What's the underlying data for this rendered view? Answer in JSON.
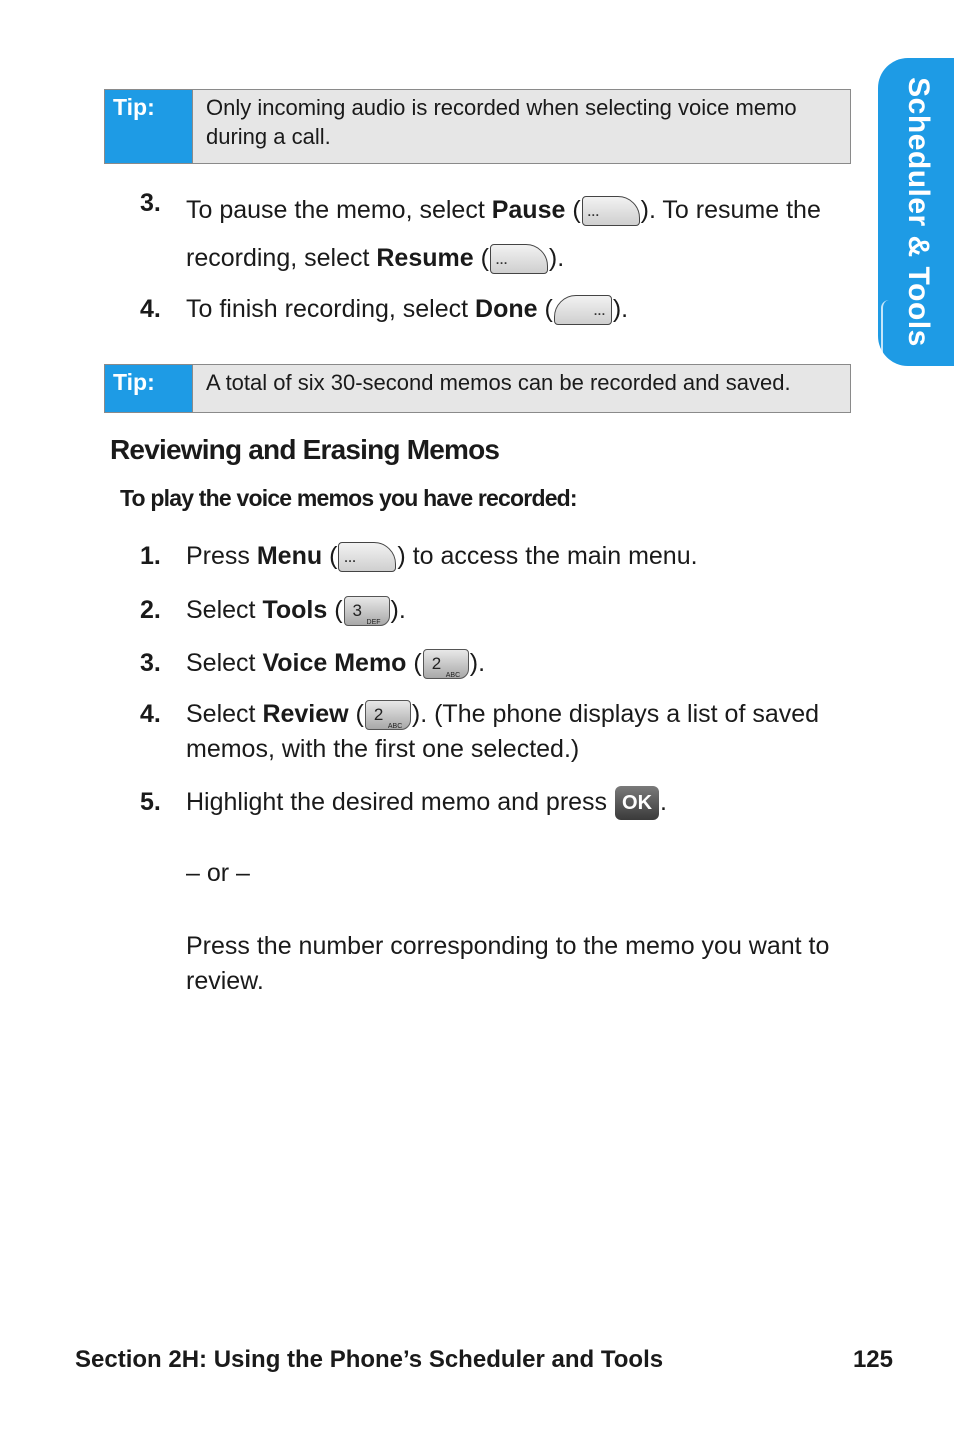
{
  "side_tab": {
    "label": "Scheduler & Tools"
  },
  "tips": [
    {
      "label": "Tip:",
      "text": "Only incoming audio is recorded when selecting voice memo during a call."
    },
    {
      "label": "Tip:",
      "text": "A total of six 30-second memos can be recorded and saved."
    }
  ],
  "steps_top": [
    {
      "num": "3.",
      "t1": "To pause the memo, select ",
      "b1": "Pause",
      "t2": " (",
      "t3": "). To resume the recording, select ",
      "b2": "Resume",
      "t4": " (",
      "t5": ")."
    },
    {
      "num": "4.",
      "t1": "To finish recording, select ",
      "b1": "Done",
      "t2": " (",
      "t3": ")."
    }
  ],
  "section": {
    "heading": "Reviewing and Erasing Memos",
    "subheading": "To play the voice memos you have recorded:",
    "steps": [
      {
        "num": "1.",
        "t1": "Press ",
        "b1": "Menu",
        "t2": " (",
        "t3": ") to access the main menu."
      },
      {
        "num": "2.",
        "t1": "Select ",
        "b1": "Tools",
        "t2": " (",
        "t3": ")."
      },
      {
        "num": "3.",
        "t1": "Select ",
        "b1": "Voice Memo",
        "t2": " (",
        "t3": ")."
      },
      {
        "num": "4.",
        "t1": "Select ",
        "b1": "Review",
        "t2": " (",
        "t3": "). (The phone displays a list of saved memos, with the first one selected.)"
      },
      {
        "num": "5.",
        "t1": "Highlight the desired memo and press ",
        "t2": ".",
        "or": "– or –",
        "alt": "Press the number corresponding to the memo you want to review."
      }
    ]
  },
  "keys": {
    "softkey_dots": "···",
    "key3_digit": "3",
    "key3_letters": "DEF",
    "key2_digit": "2",
    "key2_letters": "ABC",
    "ok": "OK"
  },
  "footer": {
    "section": "Section 2H: Using the Phone’s Scheduler and Tools",
    "page": "125"
  },
  "colors": {
    "accent": "#1e9be5",
    "tip_bg": "#e6e6e6"
  }
}
